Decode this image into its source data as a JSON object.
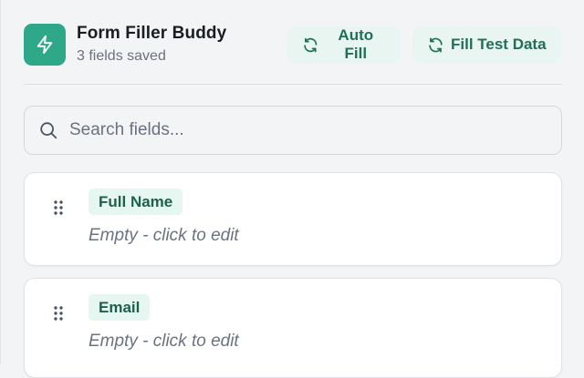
{
  "app": {
    "title": "Form Filler Buddy",
    "subtitle": "3 fields saved",
    "accent_color": "#2fa889",
    "logo_icon": "lightning-bolt-icon"
  },
  "toolbar": {
    "auto_fill_label": "Auto Fill",
    "auto_fill_icon": "refresh-icon",
    "fill_test_label": "Fill Test Data",
    "fill_test_icon": "refresh-icon"
  },
  "search": {
    "placeholder": "Search fields...",
    "value": "",
    "icon": "search-icon"
  },
  "fields": [
    {
      "label": "Full Name",
      "value": "Empty - click to edit"
    },
    {
      "label": "Email",
      "value": "Empty - click to edit"
    }
  ]
}
